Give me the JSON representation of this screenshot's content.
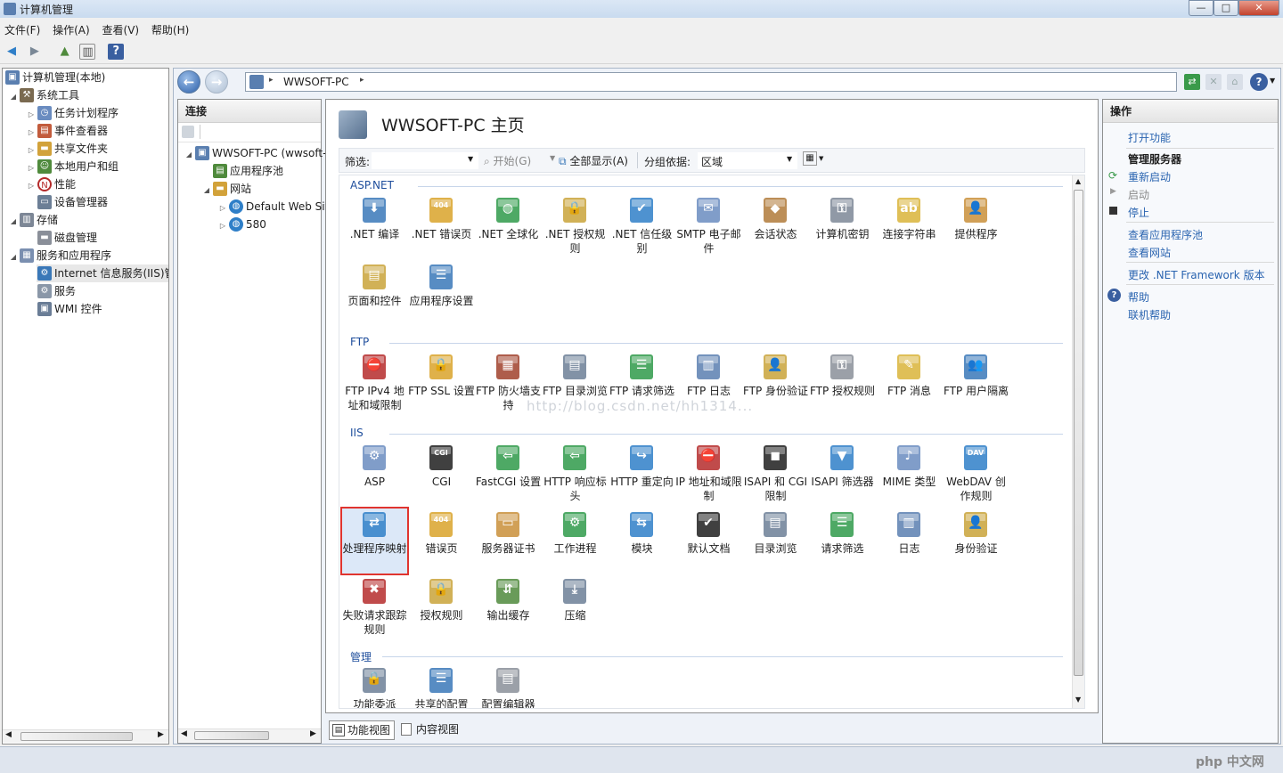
{
  "window": {
    "title": "计算机管理",
    "controls": [
      "—",
      "□",
      "✕"
    ]
  },
  "menu": [
    "文件(F)",
    "操作(A)",
    "查看(V)",
    "帮助(H)"
  ],
  "left_tree": [
    {
      "label": "计算机管理(本地)",
      "icon": "computer-management-icon",
      "color": "#5a7fb0"
    },
    {
      "label": "系统工具",
      "icon": "tools-icon",
      "color": "#7a6a50"
    },
    {
      "label": "任务计划程序",
      "icon": "clock-icon",
      "color": "#6a8cc0"
    },
    {
      "label": "事件查看器",
      "icon": "event-viewer-icon",
      "color": "#c25b3c"
    },
    {
      "label": "共享文件夹",
      "icon": "shared-folder-icon",
      "color": "#d2a23a"
    },
    {
      "label": "本地用户和组",
      "icon": "users-icon",
      "color": "#4f8a3c"
    },
    {
      "label": "性能",
      "icon": "performance-icon",
      "color": "#b52b2b"
    },
    {
      "label": "设备管理器",
      "icon": "device-manager-icon",
      "color": "#6c7f96"
    },
    {
      "label": "存储",
      "icon": "storage-icon",
      "color": "#7d8796"
    },
    {
      "label": "磁盘管理",
      "icon": "disk-icon",
      "color": "#8a8f99"
    },
    {
      "label": "服务和应用程序",
      "icon": "services-apps-icon",
      "color": "#7a8fb0"
    },
    {
      "label": "Internet 信息服务(IIS)管",
      "icon": "iis-icon",
      "color": "#3a78b8"
    },
    {
      "label": "服务",
      "icon": "gear-icon",
      "color": "#8a97a8"
    },
    {
      "label": "WMI 控件",
      "icon": "wmi-icon",
      "color": "#6a7d96"
    }
  ],
  "address": {
    "parts": [
      "WWSOFT-PC"
    ],
    "sep": "▸"
  },
  "connections": {
    "header": "连接",
    "items": [
      {
        "label": "WWSOFT-PC (wwsoft-pc\\wwsoft)",
        "icon": "server-icon",
        "color": "#5a7fb0"
      },
      {
        "label": "应用程序池",
        "icon": "app-pool-icon",
        "color": "#4f8a3c"
      },
      {
        "label": "网站",
        "icon": "sites-folder-icon",
        "color": "#d2a23a"
      },
      {
        "label": "Default Web Site",
        "icon": "globe-icon",
        "color": "#2f7fc8"
      },
      {
        "label": "580",
        "icon": "globe-icon",
        "color": "#2f7fc8"
      }
    ]
  },
  "main": {
    "title": "WWSOFT-PC 主页",
    "filter_label": "筛选:",
    "start_label": "开始(G)",
    "show_all_label": "全部显示(A)",
    "group_by_label": "分组依据:",
    "group_by_value": "区域",
    "view_switch_icon": "view-switch-icon",
    "groups": [
      {
        "name": "ASP.NET",
        "items": [
          {
            "label": ".NET 编译",
            "color": "#3a78b8",
            "glyph": "⬇"
          },
          {
            "label": ".NET 错误页",
            "color": "#d9a32a",
            "glyph": "404"
          },
          {
            "label": ".NET 全球化",
            "color": "#2f9a4a",
            "glyph": "◍"
          },
          {
            "label": ".NET 授权规则",
            "color": "#c9a33a",
            "glyph": "🔒"
          },
          {
            "label": ".NET 信任级别",
            "color": "#2f7fc8",
            "glyph": "✔"
          },
          {
            "label": "SMTP 电子邮件",
            "color": "#6a8cc0",
            "glyph": "✉"
          },
          {
            "label": "会话状态",
            "color": "#b07a3a",
            "glyph": "◆"
          },
          {
            "label": "计算机密钥",
            "color": "#7d8796",
            "glyph": "⚿"
          },
          {
            "label": "连接字符串",
            "color": "#d9b43a",
            "glyph": "ab"
          },
          {
            "label": "提供程序",
            "color": "#c98f3a",
            "glyph": "👤"
          },
          {
            "label": "页面和控件",
            "color": "#c9a33a",
            "glyph": "▤"
          },
          {
            "label": "应用程序设置",
            "color": "#3a78b8",
            "glyph": "☰"
          }
        ]
      },
      {
        "name": "FTP",
        "items": [
          {
            "label": "FTP IPv4 地址和域限制",
            "color": "#b52b2b",
            "glyph": "⛔"
          },
          {
            "label": "FTP SSL 设置",
            "color": "#d9a32a",
            "glyph": "🔒"
          },
          {
            "label": "FTP 防火墙支持",
            "color": "#a0412b",
            "glyph": "▦"
          },
          {
            "label": "FTP 目录浏览",
            "color": "#6c7f96",
            "glyph": "▤"
          },
          {
            "label": "FTP 请求筛选",
            "color": "#2f9a4a",
            "glyph": "☰"
          },
          {
            "label": "FTP 日志",
            "color": "#5a7fb0",
            "glyph": "▥"
          },
          {
            "label": "FTP 身份验证",
            "color": "#c9a33a",
            "glyph": "👤"
          },
          {
            "label": "FTP 授权规则",
            "color": "#8a8f99",
            "glyph": "⚿"
          },
          {
            "label": "FTP 消息",
            "color": "#d9b43a",
            "glyph": "✎"
          },
          {
            "label": "FTP 用户隔离",
            "color": "#3a78b8",
            "glyph": "👥"
          }
        ]
      },
      {
        "name": "IIS",
        "items": [
          {
            "label": "ASP",
            "color": "#6a8cc0",
            "glyph": "⚙"
          },
          {
            "label": "CGI",
            "color": "#1e1e1e",
            "glyph": "CGI"
          },
          {
            "label": "FastCGI 设置",
            "color": "#2f9a4a",
            "glyph": "⇦"
          },
          {
            "label": "HTTP 响应标头",
            "color": "#2f9a4a",
            "glyph": "⇦"
          },
          {
            "label": "HTTP 重定向",
            "color": "#2f7fc8",
            "glyph": "↪"
          },
          {
            "label": "IP 地址和域限制",
            "color": "#b52b2b",
            "glyph": "⛔"
          },
          {
            "label": "ISAPI 和 CGI 限制",
            "color": "#1e1e1e",
            "glyph": "◼"
          },
          {
            "label": "ISAPI 筛选器",
            "color": "#2f7fc8",
            "glyph": "▼"
          },
          {
            "label": "MIME 类型",
            "color": "#6a8cc0",
            "glyph": "♪"
          },
          {
            "label": "WebDAV 创作规则",
            "color": "#2f7fc8",
            "glyph": "DAV"
          },
          {
            "label": "处理程序映射",
            "color": "#2f7fc8",
            "glyph": "⇄",
            "selected": true
          },
          {
            "label": "错误页",
            "color": "#d9a32a",
            "glyph": "404"
          },
          {
            "label": "服务器证书",
            "color": "#c98f3a",
            "glyph": "▭"
          },
          {
            "label": "工作进程",
            "color": "#2f9a4a",
            "glyph": "⚙"
          },
          {
            "label": "模块",
            "color": "#2f7fc8",
            "glyph": "⇆"
          },
          {
            "label": "默认文档",
            "color": "#1e1e1e",
            "glyph": "✔"
          },
          {
            "label": "目录浏览",
            "color": "#6c7f96",
            "glyph": "▤"
          },
          {
            "label": "请求筛选",
            "color": "#2f9a4a",
            "glyph": "☰"
          },
          {
            "label": "日志",
            "color": "#5a7fb0",
            "glyph": "▥"
          },
          {
            "label": "身份验证",
            "color": "#c9a33a",
            "glyph": "👤"
          },
          {
            "label": "失败请求跟踪规则",
            "color": "#b52b2b",
            "glyph": "✖"
          },
          {
            "label": "授权规则",
            "color": "#c9a33a",
            "glyph": "🔒"
          },
          {
            "label": "输出缓存",
            "color": "#4f8a3c",
            "glyph": "⇵"
          },
          {
            "label": "压缩",
            "color": "#6c7f96",
            "glyph": "⤓"
          }
        ]
      },
      {
        "name": "管理",
        "items": [
          {
            "label": "功能委派",
            "color": "#6c7f96",
            "glyph": "🔒"
          },
          {
            "label": "共享的配置",
            "color": "#3a78b8",
            "glyph": "☰"
          },
          {
            "label": "配置编辑器",
            "color": "#8a8f99",
            "glyph": "▤"
          }
        ]
      }
    ],
    "watermark": "http://blog.csdn.net/hh1314..."
  },
  "bottom_tabs": [
    "功能视图",
    "内容视图"
  ],
  "actions": {
    "header": "操作",
    "open_feature": "打开功能",
    "manage_server": "管理服务器",
    "restart": "重新启动",
    "start": "启动",
    "stop": "停止",
    "view_app_pools": "查看应用程序池",
    "view_sites": "查看网站",
    "change_framework": "更改 .NET Framework 版本",
    "help": "帮助",
    "online_help": "联机帮助"
  },
  "brand": "php 中文网",
  "colors": {
    "accent": "#2a64b0",
    "selection_outline": "#e0342f"
  }
}
